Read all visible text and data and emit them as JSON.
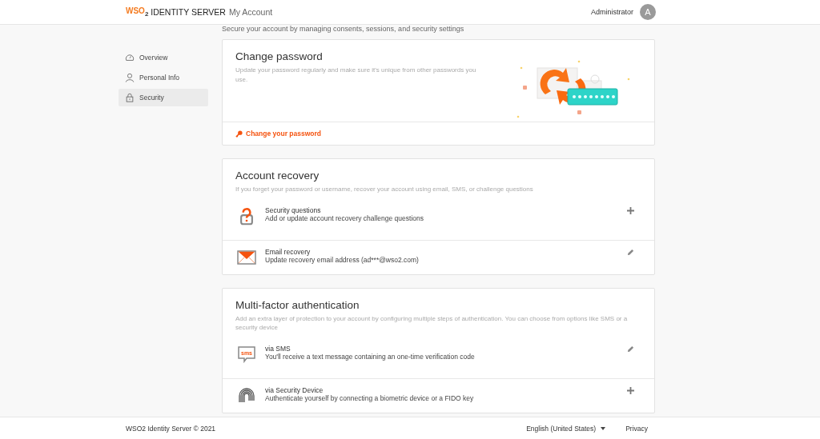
{
  "header": {
    "logo_text": "WSO",
    "logo_sub": "2",
    "product": "IDENTITY SERVER",
    "app": "My Account",
    "user": "Administrator",
    "avatar": "A"
  },
  "page_subtitle": "Secure your account by managing consents, sessions, and security settings",
  "sidebar": {
    "items": [
      {
        "label": "Overview",
        "selected": false
      },
      {
        "label": "Personal Info",
        "selected": false
      },
      {
        "label": "Security",
        "selected": true
      }
    ]
  },
  "sections": [
    {
      "kind": "password",
      "title": "Change password",
      "description": "Update your password regularly and make sure it's unique from other passwords you use.",
      "action": "Change your password"
    },
    {
      "kind": "list",
      "title": "Account recovery",
      "description": "If you forget your password or username, recover your account using email, SMS, or challenge questions",
      "rows": [
        {
          "kind": "questions",
          "title": "Security questions",
          "description": "Add or update account recovery challenge questions"
        },
        {
          "kind": "email",
          "title": "Email recovery",
          "description": "Update recovery email address (ad***@wso2.com)"
        }
      ]
    },
    {
      "kind": "list",
      "title": "Multi-factor authentication",
      "description": "Add an extra layer of protection to your account by configuring multiple steps of authentication. You can choose from options like SMS or a security device",
      "rows": [
        {
          "kind": "sms",
          "title": "via SMS",
          "description": "You'll receive a text message containing an one-time verification code",
          "sms_label": "sms"
        },
        {
          "kind": "device",
          "title": "via Security Device",
          "description": "Authenticate yourself by connecting a biometric device or a FIDO key"
        }
      ]
    }
  ],
  "footer": {
    "copyright": "WSO2 Identity Server © 2021",
    "language": "English (United States)",
    "privacy": "Privacy"
  }
}
